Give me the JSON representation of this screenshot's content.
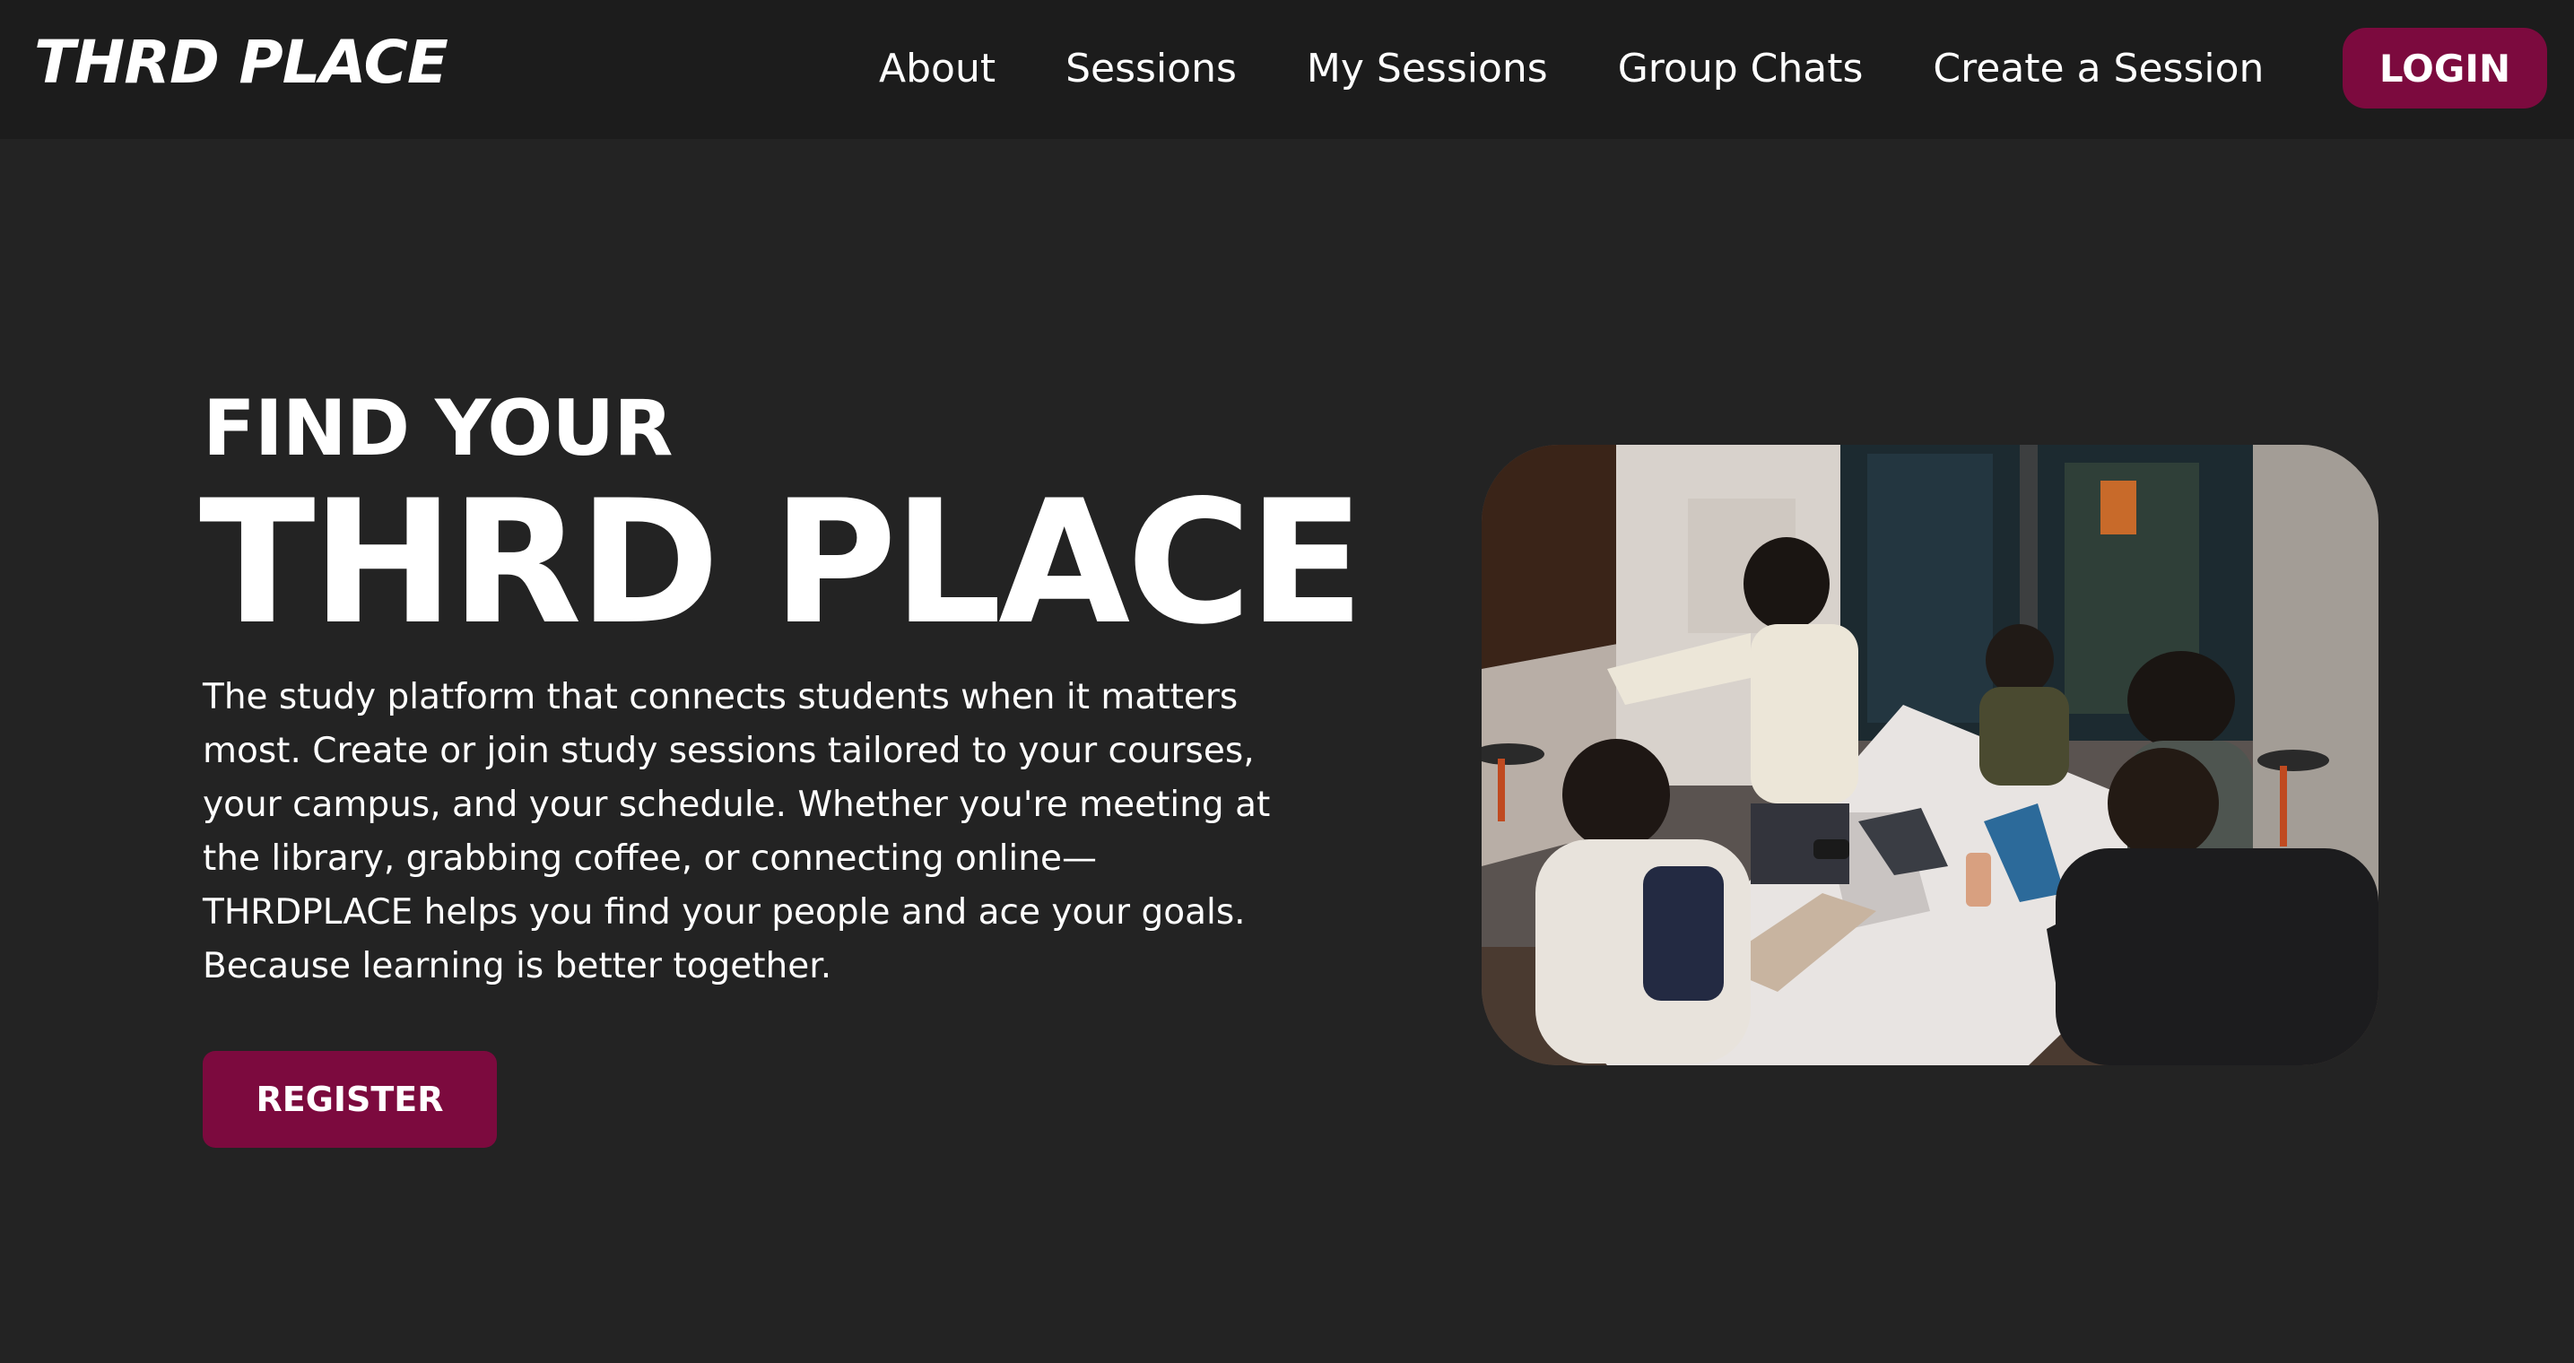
{
  "navbar": {
    "logo_text": "THRD PLACE",
    "links": [
      {
        "label": "About"
      },
      {
        "label": "Sessions"
      },
      {
        "label": "My Sessions"
      },
      {
        "label": "Group Chats"
      },
      {
        "label": "Create a Session"
      }
    ],
    "login_label": "LOGIN"
  },
  "hero": {
    "eyebrow": "FIND YOUR",
    "title": "THRD PLACE",
    "description": "The study platform that connects students when it matters most. Create or join study sessions tailored to your courses, your campus, and your schedule. Whether you're meeting at the library, grabbing coffee, or connecting online—THRDPLACE helps you find your people and ace your goals. Because learning is better together.",
    "register_label": "REGISTER"
  },
  "colors": {
    "page_background": "#232323",
    "navbar_background": "#1c1c1c",
    "accent": "#7c0a3e",
    "text": "#ffffff"
  }
}
